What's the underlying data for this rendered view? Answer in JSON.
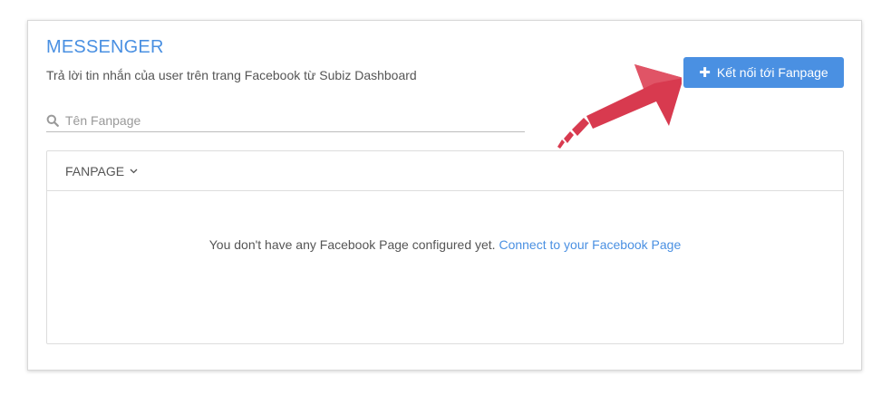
{
  "header": {
    "title": "MESSENGER",
    "subtitle": "Trả lời tin nhắn của user trên trang Facebook từ Subiz Dashboard"
  },
  "actions": {
    "connect_label": "Kết nối tới Fanpage"
  },
  "search": {
    "placeholder": "Tên Fanpage",
    "value": ""
  },
  "table": {
    "column_label": "FANPAGE",
    "empty_message": "You don't have any Facebook Page configured yet.",
    "empty_link": "Connect to your Facebook Page"
  },
  "icons": {
    "plus": "plus-icon",
    "search": "search-icon",
    "chevron": "chevron-down-icon",
    "arrow": "arrow-pointer-icon"
  },
  "colors": {
    "accent": "#4a90e2",
    "arrow": "#d83a4f"
  }
}
